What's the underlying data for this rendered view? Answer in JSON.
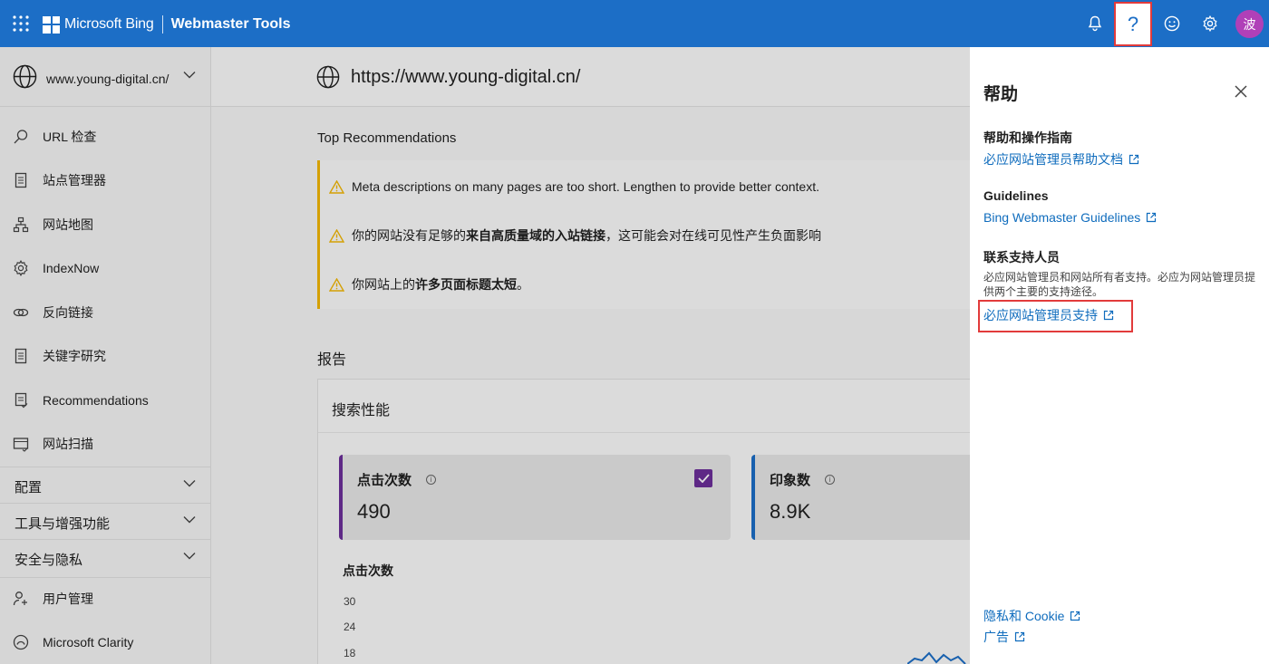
{
  "topbar": {
    "brand": "Microsoft Bing",
    "product": "Webmaster Tools",
    "help_icon_glyph": "?",
    "avatar_initial": "波",
    "bg_color": "#1c6ec6"
  },
  "sidebar": {
    "site": "www.young-digital.cn/",
    "items": [
      {
        "label": "URL 检查",
        "icon": "search-icon"
      },
      {
        "label": "站点管理器",
        "icon": "document-icon"
      },
      {
        "label": "网站地图",
        "icon": "sitemap-icon"
      },
      {
        "label": "IndexNow",
        "icon": "gear-icon"
      },
      {
        "label": "反向链接",
        "icon": "link-icon"
      },
      {
        "label": "关键字研究",
        "icon": "document-icon"
      },
      {
        "label": "Recommendations",
        "icon": "list-icon"
      },
      {
        "label": "网站扫描",
        "icon": "scan-icon"
      }
    ],
    "sections": [
      {
        "label": "配置"
      },
      {
        "label": "工具与增强功能"
      },
      {
        "label": "安全与隐私"
      }
    ],
    "bottom_items": [
      {
        "label": "用户管理",
        "icon": "user-icon"
      },
      {
        "label": "Microsoft Clarity",
        "icon": "clarity-icon"
      }
    ]
  },
  "main": {
    "url": "https://www.young-digital.cn/",
    "recommendations_title": "Top Recommendations",
    "recommendations": [
      {
        "pre": "Meta descriptions on many pages are too short. Lengthen to provide better context.",
        "bold": "",
        "post": ""
      },
      {
        "pre": "你的网站没有足够的",
        "bold": "来自高质量域的入站链接",
        "post": "，这可能会对在线可见性产生负面影响"
      },
      {
        "pre": "你网站上的",
        "bold": "许多页面标题太短",
        "post": "。"
      }
    ],
    "reports_title": "报告",
    "performance": {
      "title": "搜索性能",
      "metrics": [
        {
          "label": "点击次数",
          "value": "490",
          "color": "#6b2e99",
          "checked": true
        },
        {
          "label": "印象数",
          "value": "8.9K",
          "color": "#1c6ec6",
          "checked": false
        }
      ],
      "chart_title": "点击次数",
      "y_ticks": [
        "30",
        "24",
        "18"
      ]
    }
  },
  "help_panel": {
    "title": "帮助",
    "sections": [
      {
        "heading": "帮助和操作指南",
        "link": "必应网站管理员帮助文档"
      },
      {
        "heading": "Guidelines",
        "link": "Bing Webmaster Guidelines"
      },
      {
        "heading": "联系支持人员",
        "description": "必应网站管理员和网站所有者支持。必应为网站管理员提供两个主要的支持途径。",
        "link": "必应网站管理员支持"
      }
    ],
    "footer_links": [
      "隐私和 Cookie",
      "广告"
    ]
  },
  "colors": {
    "accent": "#1c6ec6",
    "link": "#0f6cbd",
    "warning": "#f2b705",
    "highlight": "#e23b3b"
  }
}
